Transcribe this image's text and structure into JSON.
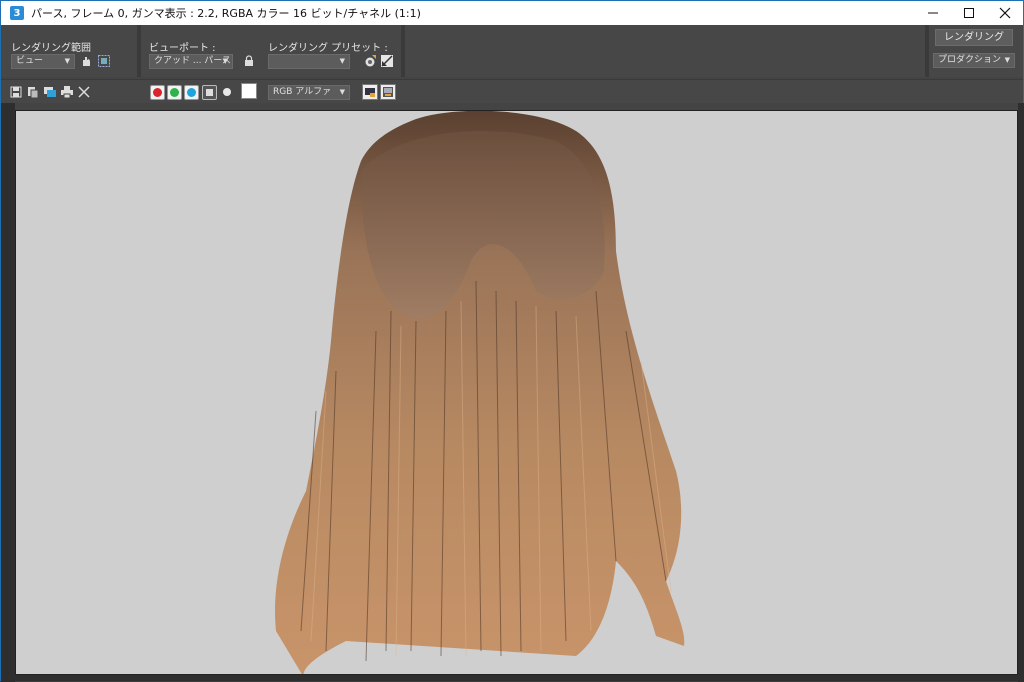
{
  "window": {
    "title": "パース, フレーム 0, ガンマ表示 : 2.2, RGBA カラー 16 ビット/チャネル (1:1)",
    "app_icon": "3",
    "controls": {
      "minimize": "—",
      "maximize": "☐",
      "close": "✕"
    }
  },
  "toolbar": {
    "area_label": "レンダリング範囲",
    "area_value": "ビュー",
    "viewport_label": "ビューポート :",
    "viewport_value": "クアッド ... パース",
    "preset_label": "レンダリング プリセット :",
    "preset_value": "",
    "render_button": "レンダリング",
    "production_value": "プロダクション"
  },
  "channel_bar": {
    "display_value": "RGB アルファ",
    "colors": {
      "red": "#d9262c",
      "green": "#2fb34a",
      "blue": "#1fa3dc"
    }
  },
  "icons": [
    "save-icon",
    "copy-icon",
    "clone-icon",
    "print-icon",
    "clear-icon",
    "lock-icon",
    "pan-icon",
    "region-icon",
    "preset-load-icon",
    "preset-save-icon",
    "display-toggle-icon",
    "frame-buffer-icon"
  ]
}
